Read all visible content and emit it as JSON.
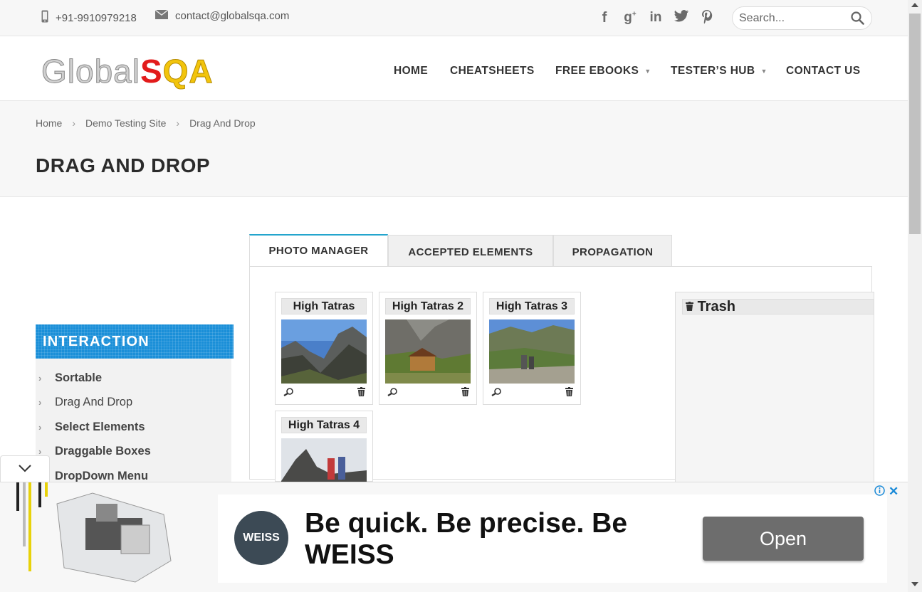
{
  "topbar": {
    "phone": "+91-9910979218",
    "email": "contact@globalsqa.com",
    "social": [
      "facebook-icon",
      "google-plus-icon",
      "linkedin-icon",
      "twitter-icon",
      "pinterest-icon"
    ],
    "search_placeholder": "Search..."
  },
  "logo": {
    "part1": "Global",
    "part2": "S",
    "part3": "QA"
  },
  "nav": {
    "home": "HOME",
    "cheatsheets": "CHEATSHEETS",
    "free_ebooks": "FREE EBOOKS",
    "testers_hub": "TESTER’S HUB",
    "contact_us": "CONTACT US"
  },
  "breadcrumb": {
    "home": "Home",
    "demo": "Demo Testing Site",
    "current": "Drag And Drop"
  },
  "page_title": "DRAG AND DROP",
  "sidebar": {
    "heading": "INTERACTION",
    "items": [
      "Sortable",
      "Drag And Drop",
      "Select Elements",
      "Draggable Boxes",
      "DropDown Menu"
    ]
  },
  "tabs": {
    "photo_manager": "PHOTO MANAGER",
    "accepted_elements": "ACCEPTED ELEMENTS",
    "propagation": "PROPAGATION"
  },
  "photos": {
    "p1": "High Tatras",
    "p2": "High Tatras 2",
    "p3": "High Tatras 3",
    "p4": "High Tatras 4"
  },
  "trash": {
    "title": "Trash"
  },
  "ad": {
    "logo_text": "WEISS",
    "headline": "Be quick. Be precise. Be WEISS",
    "button": "Open"
  },
  "colors": {
    "accent": "#24a5cd",
    "sidebar_head": "#1a8fd8",
    "logo_red": "#e21b1b",
    "logo_yellow": "#f2c40c"
  }
}
